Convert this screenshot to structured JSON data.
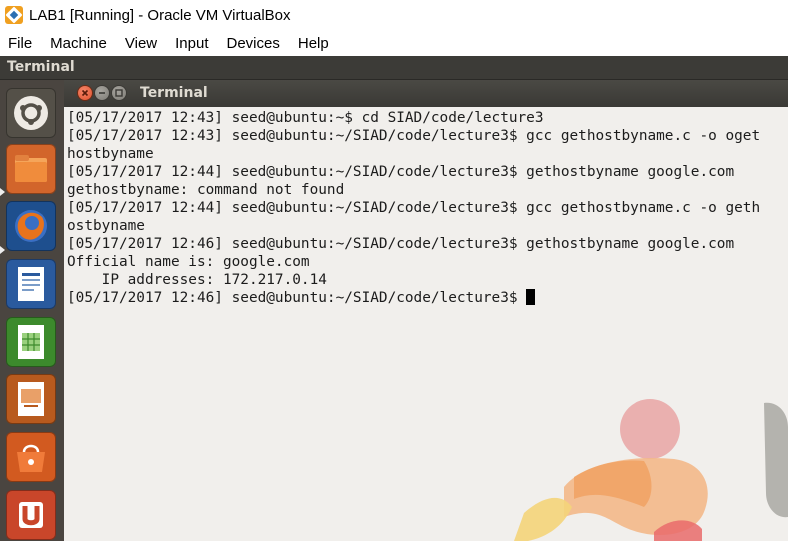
{
  "window": {
    "title": "LAB1 [Running] - Oracle VM VirtualBox"
  },
  "menu": [
    "File",
    "Machine",
    "View",
    "Input",
    "Devices",
    "Help"
  ],
  "guest": {
    "topbar_title": "Terminal",
    "launcher_items": [
      "dash-home",
      "files",
      "firefox",
      "libreoffice-writer",
      "libreoffice-calc",
      "libreoffice-impress",
      "ubuntu-software",
      "ubuntu-one"
    ]
  },
  "terminal": {
    "title": "Terminal",
    "lines": [
      "[05/17/2017 12:43] seed@ubuntu:~$ cd SIAD/code/lecture3",
      "[05/17/2017 12:43] seed@ubuntu:~/SIAD/code/lecture3$ gcc gethostbyname.c -o oget",
      "hostbyname",
      "[05/17/2017 12:44] seed@ubuntu:~/SIAD/code/lecture3$ gethostbyname google.com",
      "gethostbyname: command not found",
      "[05/17/2017 12:44] seed@ubuntu:~/SIAD/code/lecture3$ gcc gethostbyname.c -o geth",
      "ostbyname",
      "[05/17/2017 12:46] seed@ubuntu:~/SIAD/code/lecture3$ gethostbyname google.com",
      "Official name is: google.com",
      "    IP addresses: 172.217.0.14"
    ],
    "prompt": "[05/17/2017 12:46] seed@ubuntu:~/SIAD/code/lecture3$ "
  },
  "colors": {
    "terminal_bg": "#f1efec",
    "launcher_bg": "#4a4540",
    "close_button": "#e0512c"
  }
}
